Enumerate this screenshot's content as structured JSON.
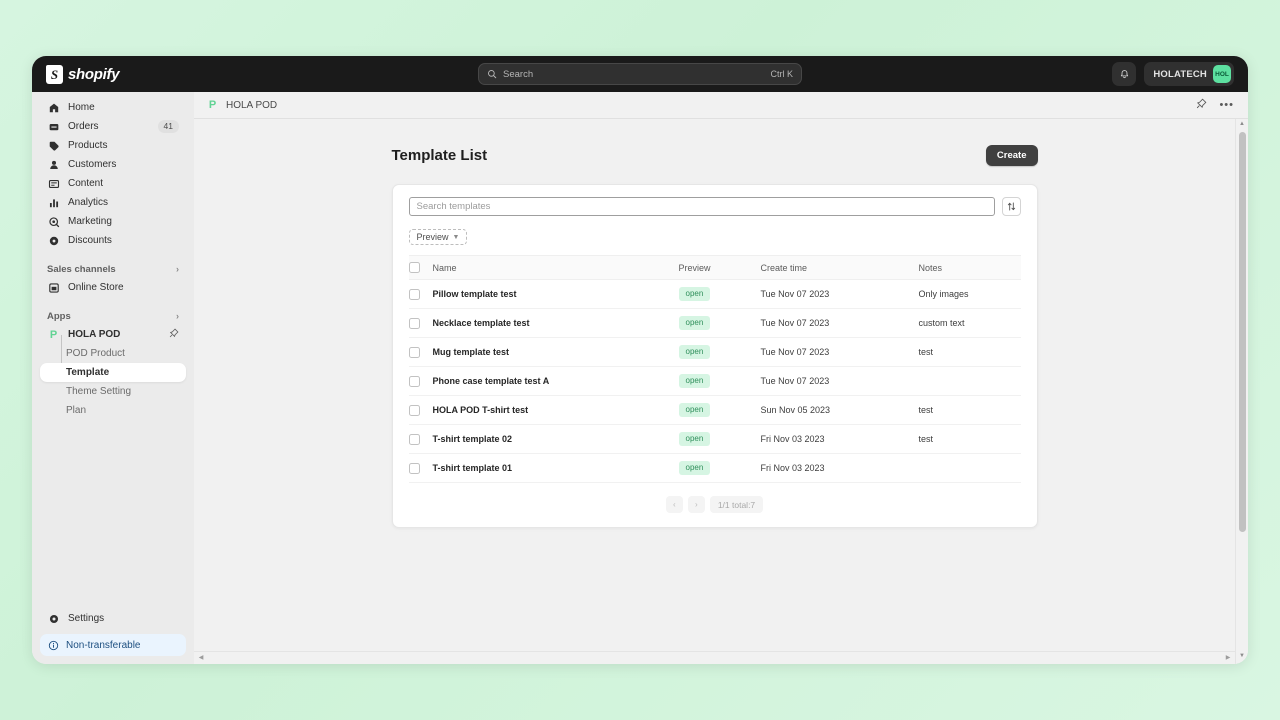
{
  "topbar": {
    "brand": "shopify",
    "search_placeholder": "Search",
    "search_shortcut": "Ctrl K",
    "user_name": "HOLATECH",
    "avatar_initials": "HOL"
  },
  "sidebar": {
    "items": [
      {
        "label": "Home",
        "icon": "home-icon",
        "badge": ""
      },
      {
        "label": "Orders",
        "icon": "orders-icon",
        "badge": "41"
      },
      {
        "label": "Products",
        "icon": "products-icon",
        "badge": ""
      },
      {
        "label": "Customers",
        "icon": "customers-icon",
        "badge": ""
      },
      {
        "label": "Content",
        "icon": "content-icon",
        "badge": ""
      },
      {
        "label": "Analytics",
        "icon": "analytics-icon",
        "badge": ""
      },
      {
        "label": "Marketing",
        "icon": "marketing-icon",
        "badge": ""
      },
      {
        "label": "Discounts",
        "icon": "discounts-icon",
        "badge": ""
      }
    ],
    "sales_channels_label": "Sales channels",
    "online_store_label": "Online Store",
    "apps_label": "Apps",
    "app_name": "HOLA POD",
    "app_subitems": [
      {
        "label": "POD Product",
        "active": false
      },
      {
        "label": "Template",
        "active": true
      },
      {
        "label": "Theme Setting",
        "active": false
      },
      {
        "label": "Plan",
        "active": false
      }
    ],
    "settings_label": "Settings",
    "non_transferable_label": "Non-transferable"
  },
  "breadcrumb": {
    "app_label": "HOLA POD"
  },
  "page": {
    "title": "Template List",
    "create_label": "Create"
  },
  "toolbar": {
    "search_placeholder": "Search templates",
    "filter_chip": "Preview"
  },
  "table": {
    "columns": [
      "Name",
      "Preview",
      "Create time",
      "Notes"
    ],
    "rows": [
      {
        "name": "Pillow template test",
        "preview": "open",
        "create_time": "Tue Nov 07 2023",
        "notes": "Only images"
      },
      {
        "name": "Necklace template test",
        "preview": "open",
        "create_time": "Tue Nov 07 2023",
        "notes": "custom text"
      },
      {
        "name": "Mug template test",
        "preview": "open",
        "create_time": "Tue Nov 07 2023",
        "notes": "test"
      },
      {
        "name": "Phone case template test A",
        "preview": "open",
        "create_time": "Tue Nov 07 2023",
        "notes": ""
      },
      {
        "name": "HOLA POD T-shirt test",
        "preview": "open",
        "create_time": "Sun Nov 05 2023",
        "notes": "test"
      },
      {
        "name": "T-shirt template 02",
        "preview": "open",
        "create_time": "Fri Nov 03 2023",
        "notes": "test"
      },
      {
        "name": "T-shirt template 01",
        "preview": "open",
        "create_time": "Fri Nov 03 2023",
        "notes": ""
      }
    ]
  },
  "pagination": {
    "prev": "‹",
    "next": "›",
    "total_label": "1/1 total:7"
  },
  "colors": {
    "accent_green": "#5de0a0",
    "badge_bg": "#d6f5e3",
    "badge_text": "#2f8f5b",
    "topbar_bg": "#1a1a1a",
    "page_bg": "#d3f4de",
    "info_bg": "#eaf4fe"
  }
}
